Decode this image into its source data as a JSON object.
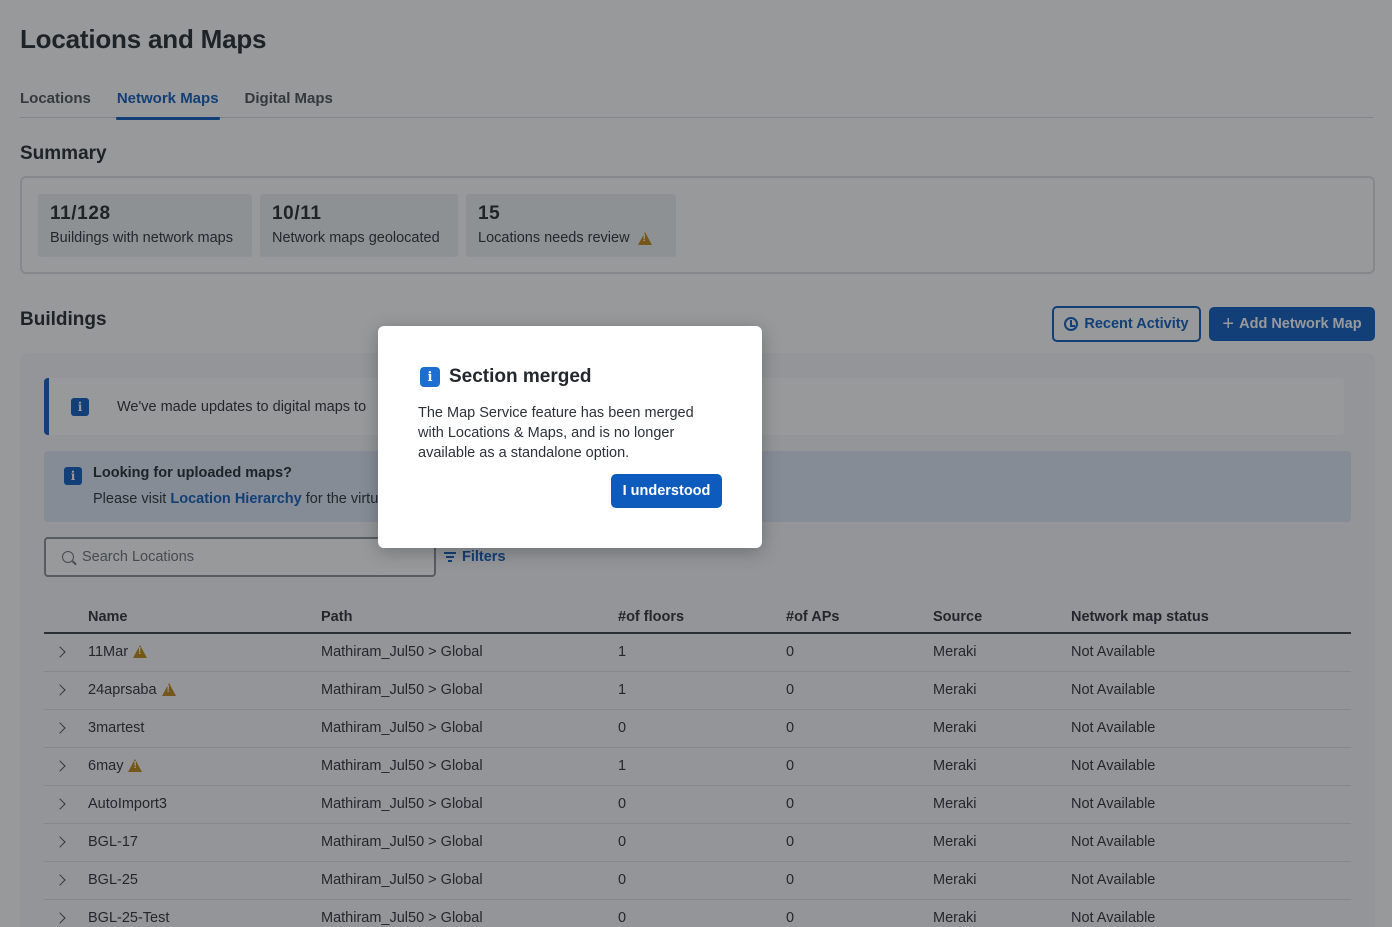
{
  "page": {
    "title": "Locations and Maps"
  },
  "tabs": [
    {
      "label": "Locations",
      "active": false
    },
    {
      "label": "Network Maps",
      "active": true
    },
    {
      "label": "Digital Maps",
      "active": false
    }
  ],
  "summary": {
    "title": "Summary",
    "stats": [
      {
        "value": "11/128",
        "label": "Buildings with network maps"
      },
      {
        "value": "10/11",
        "label": "Network maps geolocated"
      },
      {
        "value": "15",
        "label": "Locations needs review",
        "icon": "warning-icon"
      }
    ]
  },
  "buildings": {
    "title": "Buildings",
    "recent_activity_label": "Recent Activity",
    "add_network_map_label": "Add Network Map",
    "inline_alert_text": "We've made updates to digital maps to",
    "banner": {
      "title": "Looking for uploaded maps?",
      "text_prefix": "Please visit ",
      "link": "Location Hierarchy",
      "text_suffix": " for the virtu"
    },
    "search_placeholder": "Search Locations",
    "filters_label": "Filters",
    "columns": [
      "Name",
      "Path",
      "#of floors",
      "#of APs",
      "Source",
      "Network map status"
    ],
    "rows": [
      {
        "name": "11Mar",
        "warn": true,
        "path": "Mathiram_Jul50 > Global",
        "floors": "1",
        "aps": "0",
        "source": "Meraki",
        "status": "Not Available"
      },
      {
        "name": "24aprsaba",
        "warn": true,
        "path": "Mathiram_Jul50 > Global",
        "floors": "1",
        "aps": "0",
        "source": "Meraki",
        "status": "Not Available"
      },
      {
        "name": "3martest",
        "warn": false,
        "path": "Mathiram_Jul50 > Global",
        "floors": "0",
        "aps": "0",
        "source": "Meraki",
        "status": "Not Available"
      },
      {
        "name": "6may",
        "warn": true,
        "path": "Mathiram_Jul50 > Global",
        "floors": "1",
        "aps": "0",
        "source": "Meraki",
        "status": "Not Available"
      },
      {
        "name": "AutoImport3",
        "warn": false,
        "path": "Mathiram_Jul50 > Global",
        "floors": "0",
        "aps": "0",
        "source": "Meraki",
        "status": "Not Available"
      },
      {
        "name": "BGL-17",
        "warn": false,
        "path": "Mathiram_Jul50 > Global",
        "floors": "0",
        "aps": "0",
        "source": "Meraki",
        "status": "Not Available"
      },
      {
        "name": "BGL-25",
        "warn": false,
        "path": "Mathiram_Jul50 > Global",
        "floors": "0",
        "aps": "0",
        "source": "Meraki",
        "status": "Not Available"
      },
      {
        "name": "BGL-25-Test",
        "warn": false,
        "path": "Mathiram_Jul50 > Global",
        "floors": "0",
        "aps": "0",
        "source": "Meraki",
        "status": "Not Available"
      }
    ]
  },
  "modal": {
    "title": "Section merged",
    "body": "The Map Service feature has been merged with Locations & Maps, and is no longer available as a standalone option.",
    "button_label": "I understood"
  },
  "colors": {
    "accent": "#0d5cbd",
    "warning": "#c18716"
  }
}
